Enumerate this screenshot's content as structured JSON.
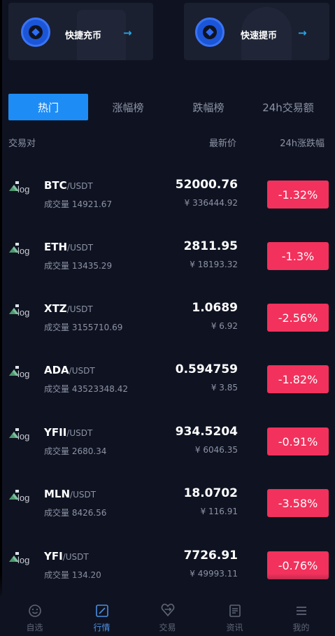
{
  "quick_actions": [
    {
      "label": "快捷充币",
      "icon": "coin-icon",
      "arrow": "→"
    },
    {
      "label": "快速提币",
      "icon": "coin-icon",
      "arrow": "→"
    }
  ],
  "tabs": [
    {
      "label": "热门",
      "active": true
    },
    {
      "label": "涨幅榜",
      "active": false
    },
    {
      "label": "跌幅榜",
      "active": false
    },
    {
      "label": "24h交易额",
      "active": false
    }
  ],
  "columns": {
    "pair": "交易对",
    "price": "最新价",
    "change": "24h涨跌幅"
  },
  "logo_alt": "log",
  "rows": [
    {
      "base": "BTC",
      "quote": "/USDT",
      "volume": "成交量 14921.67",
      "price": "52000.76",
      "cny": "¥ 336444.92",
      "change": "-1.32%"
    },
    {
      "base": "ETH",
      "quote": "/USDT",
      "volume": "成交量 13435.29",
      "price": "2811.95",
      "cny": "¥ 18193.32",
      "change": "-1.3%"
    },
    {
      "base": "XTZ",
      "quote": "/USDT",
      "volume": "成交量 3155710.69",
      "price": "1.0689",
      "cny": "¥ 6.92",
      "change": "-2.56%"
    },
    {
      "base": "ADA",
      "quote": "/USDT",
      "volume": "成交量 43523348.42",
      "price": "0.594759",
      "cny": "¥ 3.85",
      "change": "-1.82%"
    },
    {
      "base": "YFII",
      "quote": "/USDT",
      "volume": "成交量 2680.34",
      "price": "934.5204",
      "cny": "¥ 6046.35",
      "change": "-0.91%"
    },
    {
      "base": "MLN",
      "quote": "/USDT",
      "volume": "成交量 8426.56",
      "price": "18.0702",
      "cny": "¥ 116.91",
      "change": "-3.58%"
    },
    {
      "base": "YFI",
      "quote": "/USDT",
      "volume": "成交量 134.20",
      "price": "7726.91",
      "cny": "¥ 49993.11",
      "change": "-0.76%"
    }
  ],
  "colors": {
    "background": "#0f1321",
    "card": "#1a2030",
    "accent": "#1e8cf5",
    "down": "#f2315c",
    "muted": "#8d93a6"
  },
  "bottom_nav": [
    {
      "label": "自选",
      "icon": "smiley-icon",
      "active": false
    },
    {
      "label": "行情",
      "icon": "chart-icon",
      "active": true
    },
    {
      "label": "交易",
      "icon": "exchange-icon",
      "active": false
    },
    {
      "label": "资讯",
      "icon": "news-icon",
      "active": false
    },
    {
      "label": "我的",
      "icon": "menu-icon",
      "active": false
    }
  ]
}
